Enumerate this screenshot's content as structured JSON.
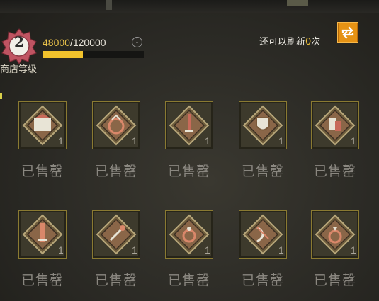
{
  "shop": {
    "level": "2",
    "level_label": "商店等级",
    "exp_current": "48000",
    "exp_sep": "/",
    "exp_max": "120000",
    "exp_progress": 0.4,
    "info_glyph": "i",
    "refresh_prefix": "还可以刷新",
    "refresh_count": "0",
    "refresh_suffix": "次"
  },
  "colors": {
    "accent_gold": "#f2c22c",
    "button_orange": "#e59214",
    "sold_text": "#8a8780"
  },
  "items": [
    {
      "icon": "chest-armor-icon",
      "qty": "1",
      "status": "已售罄"
    },
    {
      "icon": "round-amulet-icon",
      "qty": "1",
      "status": "已售罄"
    },
    {
      "icon": "dagger-icon",
      "qty": "1",
      "status": "已售罄"
    },
    {
      "icon": "shield-icon",
      "qty": "1",
      "status": "已售罄"
    },
    {
      "icon": "gloves-icon",
      "qty": "1",
      "status": "已售罄"
    },
    {
      "icon": "sword-icon",
      "qty": "1",
      "status": "已售罄"
    },
    {
      "icon": "key-icon",
      "qty": "1",
      "status": "已售罄"
    },
    {
      "icon": "ring-icon",
      "qty": "1",
      "status": "已售罄"
    },
    {
      "icon": "bow-icon",
      "qty": "1",
      "status": "已售罄"
    },
    {
      "icon": "ring-gem-icon",
      "qty": "1",
      "status": "已售罄"
    }
  ]
}
